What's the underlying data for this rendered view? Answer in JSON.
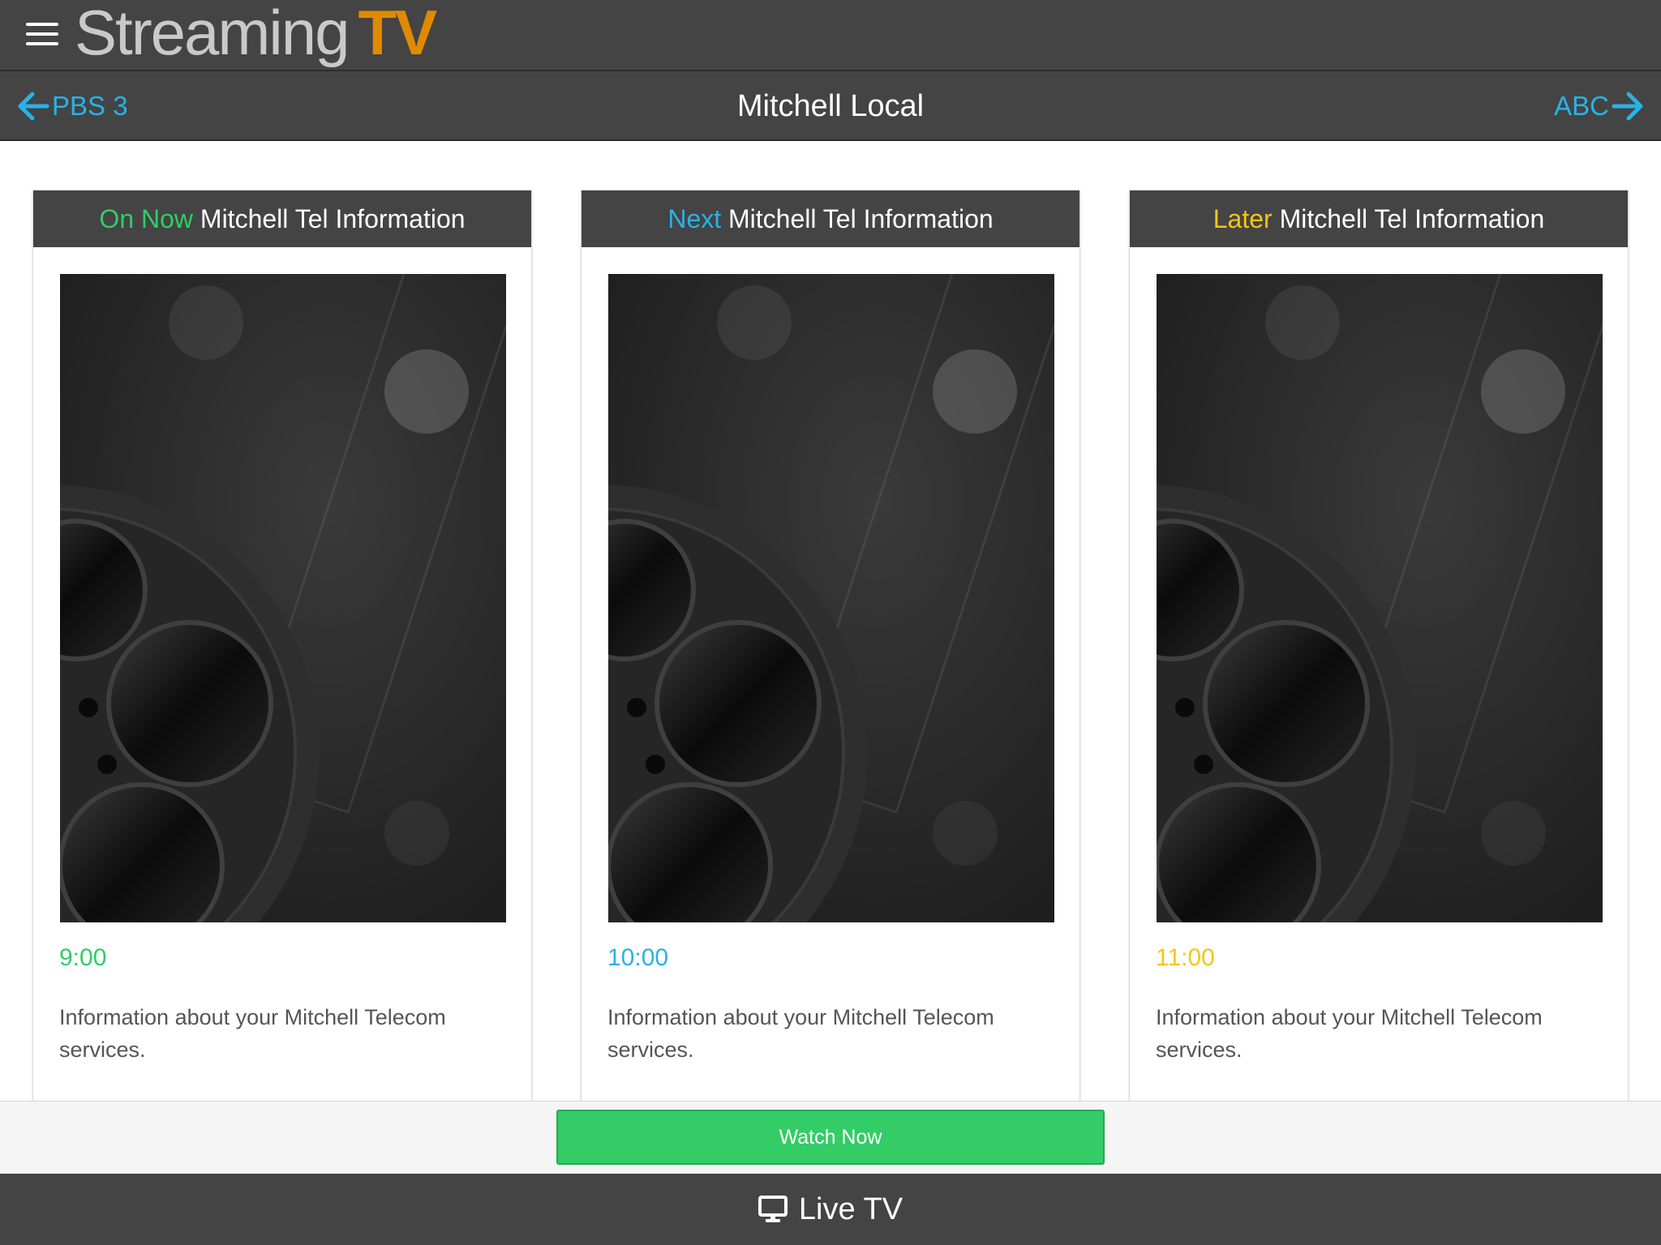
{
  "app": {
    "logo_part1": "Streaming",
    "logo_part2": "TV",
    "logo_color": "#e08a00"
  },
  "channel_nav": {
    "prev_label": "PBS 3",
    "current_title": "Mitchell Local",
    "next_label": "ABC",
    "link_color": "#29b2e6"
  },
  "programs": [
    {
      "slot_label": "On Now",
      "slot_color": "#33cc66",
      "title": "Mitchell Tel Information",
      "time": "9:00",
      "description": "Information about your Mitchell Telecom services."
    },
    {
      "slot_label": "Next",
      "slot_color": "#29b2e6",
      "title": "Mitchell Tel Information",
      "time": "10:00",
      "description": "Information about your Mitchell Telecom services."
    },
    {
      "slot_label": "Later",
      "slot_color": "#f5c518",
      "title": "Mitchell Tel Information",
      "time": "11:00",
      "description": "Information about your Mitchell Telecom services."
    }
  ],
  "actions": {
    "watch_now_label": "Watch Now",
    "watch_now_color": "#33cc66"
  },
  "footer": {
    "live_tv_label": "Live TV",
    "icon": "monitor-icon"
  }
}
